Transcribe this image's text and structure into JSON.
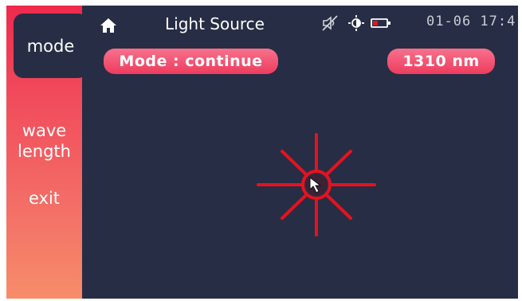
{
  "sidebar": {
    "items": [
      {
        "label": "mode",
        "active": true
      },
      {
        "label": "wave\nlength",
        "active": false
      },
      {
        "label": "exit",
        "active": false
      }
    ]
  },
  "header": {
    "title": "Light Source",
    "datetime": "01-06 17:4",
    "icons": [
      "home-icon",
      "mute-icon",
      "brightness-icon",
      "battery-low-icon"
    ]
  },
  "controls": {
    "mode": "Mode : continue",
    "wavelength": "1310 nm"
  },
  "colors": {
    "screen_bg": "#272d44",
    "accent": "#ee3c5f",
    "laser": "#e6121e"
  }
}
